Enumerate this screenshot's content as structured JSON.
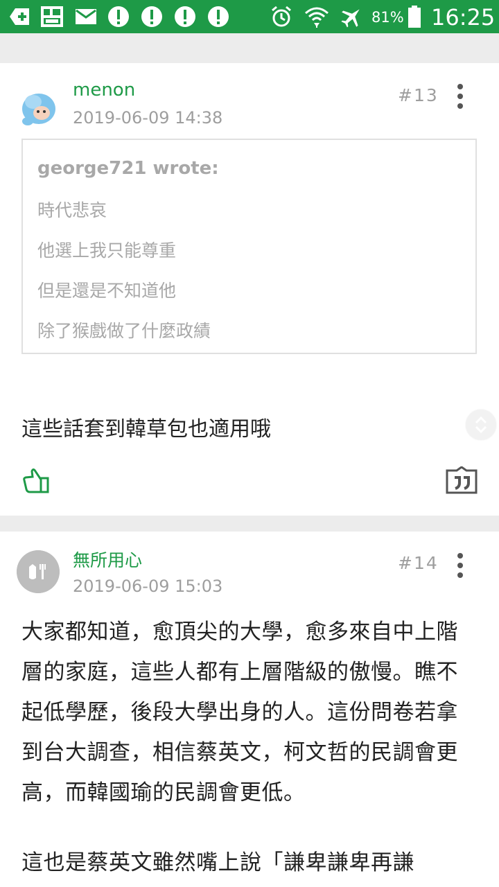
{
  "status_bar": {
    "battery": "81%",
    "time": "16:25"
  },
  "posts": [
    {
      "author": "menon",
      "timestamp": "2019-06-09 14:38",
      "floor": "#13",
      "quote": {
        "author": "george721 wrote:",
        "lines": [
          "時代悲哀",
          "他選上我只能尊重",
          "但是還是不知道他",
          "除了猴戲做了什麼政績"
        ]
      },
      "text": "這些話套到韓草包也適用哦"
    },
    {
      "author": "無所用心",
      "timestamp": "2019-06-09 15:03",
      "floor": "#14",
      "paragraph1": "大家都知道，愈頂尖的大學，愈多來自中上階層的家庭，這些人都有上層階級的傲慢。瞧不起低學歷，後段大學出身的人。這份問卷若拿到台大調查，相信蔡英文，柯文哲的民調會更高，而韓國瑜的民調會更低。",
      "paragraph2": "這也是蔡英文雖然嘴上說「謙卑謙卑再謙"
    }
  ]
}
